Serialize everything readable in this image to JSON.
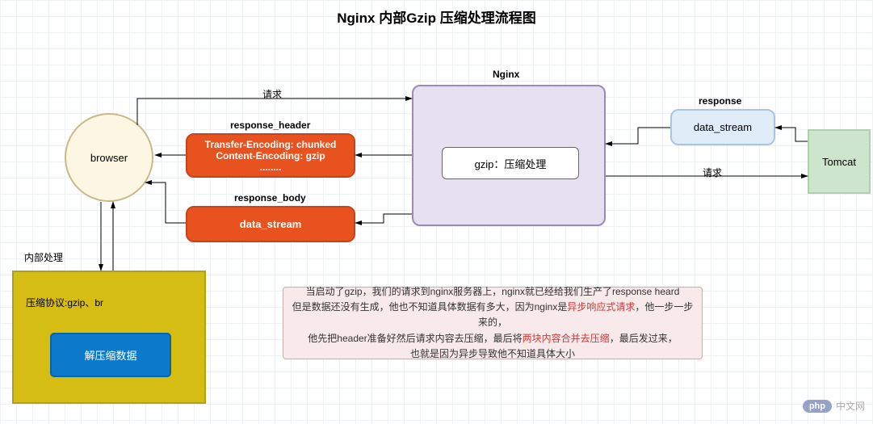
{
  "title": "Nginx 内部Gzip 压缩处理流程图",
  "nodes": {
    "browser": "browser",
    "response_header_label": "response_header",
    "response_header_lines": {
      "l1": "Transfer-Encoding: chunked",
      "l2": "Content-Encoding: gzip",
      "l3": "........"
    },
    "response_body_label": "response_body",
    "response_body_text": "data_stream",
    "nginx_label": "Nginx",
    "nginx_inner": "gzip：压缩处理",
    "tomcat": "Tomcat",
    "response_stream_label": "response",
    "response_stream_text": "data_stream",
    "yellow_label": "压缩协议:gzip、br",
    "decomp": "解压缩数据"
  },
  "edges": {
    "req1": "请求",
    "req2": "请求",
    "internal": "内部处理"
  },
  "note": {
    "t1_a": "当启动了gzip，我们的请求到nginx服务器上，nginx就已经给我们生产了response heard",
    "t2_a": "但是数据还没有生成，他也不知道具体数据有多大，因为nginx是",
    "t2_hl": "异步响应式请求",
    "t2_b": "，他一步一步来的，",
    "t3_a": "他先把header准备好然后请求内容去压缩，最后将",
    "t3_hl": "两块内容合并去压缩",
    "t3_b": "，最后发过来，",
    "t4": "也就是因为异步导致他不知道具体大小"
  },
  "watermark": {
    "badge": "php",
    "text": "中文网"
  }
}
